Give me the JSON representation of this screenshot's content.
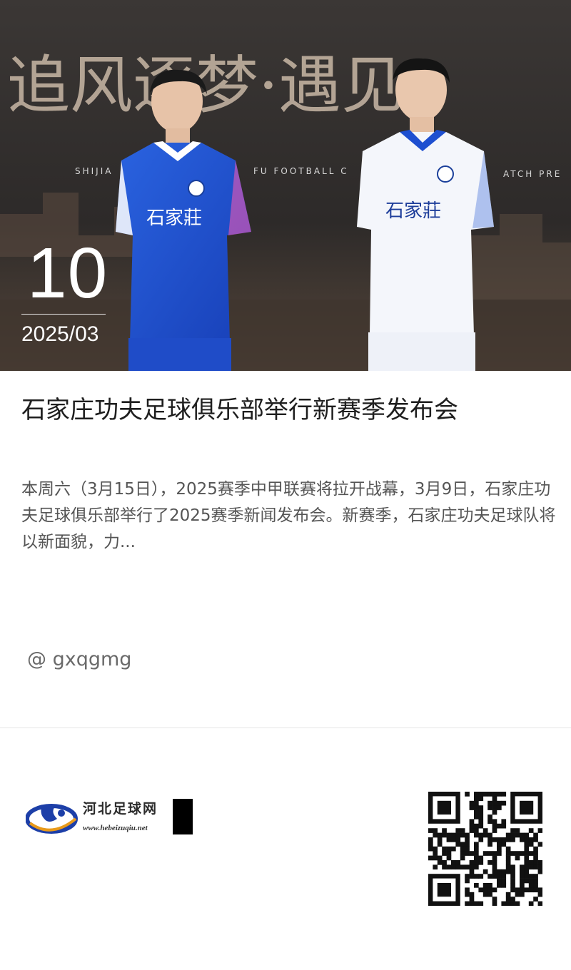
{
  "hero": {
    "banner_text": "追风逐梦·遇见",
    "banner_sub_left": "SHIJIA",
    "banner_sub_mid": "FU FOOTBALL C",
    "banner_sub_right": "ATCH PRE",
    "jersey_text_left": "石家莊",
    "jersey_text_right": "石家莊",
    "image_colors": {
      "jersey_home": "#1e4fd0",
      "jersey_away": "#f4f6fb"
    }
  },
  "date": {
    "day": "10",
    "year_month": "2025/03"
  },
  "article": {
    "title": "石家庄功夫足球俱乐部举行新赛季发布会",
    "summary": "本周六（3月15日），2025赛季中甲联赛将拉开战幕，3月9日，石家庄功夫足球俱乐部举行了2025赛季新闻发布会。新赛季，石家庄功夫足球队将以新面貌，力...",
    "author": "@ gxqgmg"
  },
  "footer": {
    "logo_name": "河北足球网",
    "logo_url": "www.hebeizuqiu.net",
    "qr_icon": "qr-code-icon"
  }
}
